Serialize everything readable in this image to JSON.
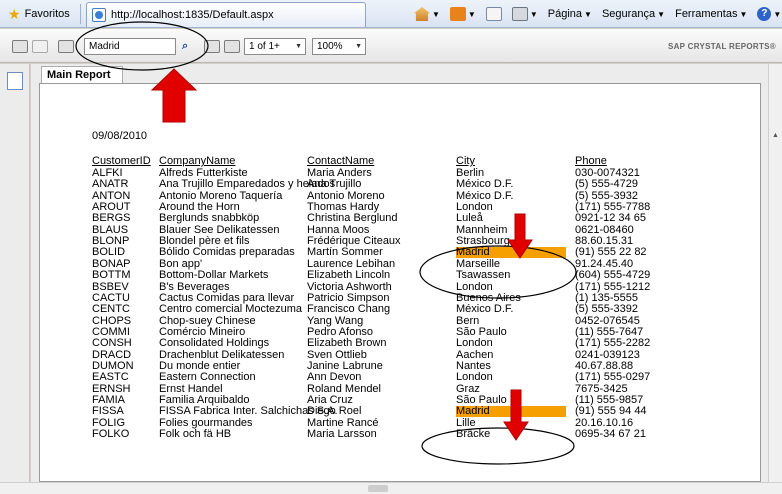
{
  "browser": {
    "favorites_label": "Favoritos",
    "tab_title": "http://localhost:1835/Default.aspx",
    "menu_page": "Página",
    "menu_security": "Segurança",
    "menu_tools": "Ferramentas"
  },
  "crystal": {
    "search_value": "Madrid",
    "page_value": "1 of 1+",
    "zoom_value": "100%",
    "brand": "SAP CRYSTAL REPORTS®",
    "main_tab": "Main Report"
  },
  "report": {
    "date": "09/08/2010",
    "columns": [
      "CustomerID",
      "CompanyName",
      "ContactName",
      "City",
      "Phone"
    ],
    "highlight_color": "#f5a000",
    "rows": [
      [
        "ALFKI",
        "Alfreds Futterkiste",
        "Maria Anders",
        "Berlin",
        "030-0074321"
      ],
      [
        "ANATR",
        "Ana Trujillo Emparedados y helados",
        "Ana Trujillo",
        "México D.F.",
        "(5) 555-4729"
      ],
      [
        "ANTON",
        "Antonio Moreno Taquería",
        "Antonio Moreno",
        "México D.F.",
        "(5) 555-3932"
      ],
      [
        "AROUT",
        "Around the Horn",
        "Thomas Hardy",
        "London",
        "(171) 555-7788"
      ],
      [
        "BERGS",
        "Berglunds snabbköp",
        "Christina Berglund",
        "Luleå",
        "0921-12 34 65"
      ],
      [
        "BLAUS",
        "Blauer See Delikatessen",
        "Hanna Moos",
        "Mannheim",
        "0621-08460"
      ],
      [
        "BLONP",
        "Blondel père et fils",
        "Frédérique Citeaux",
        "Strasbourg",
        "88.60.15.31"
      ],
      [
        "BOLID",
        "Bólido Comidas preparadas",
        "Martín Sommer",
        "Madrid",
        "(91) 555 22 82"
      ],
      [
        "BONAP",
        "Bon app'",
        "Laurence Lebihan",
        "Marseille",
        "91.24.45.40"
      ],
      [
        "BOTTM",
        "Bottom-Dollar Markets",
        "Elizabeth Lincoln",
        "Tsawassen",
        "(604) 555-4729"
      ],
      [
        "BSBEV",
        "B's Beverages",
        "Victoria Ashworth",
        "London",
        "(171) 555-1212"
      ],
      [
        "CACTU",
        "Cactus Comidas para llevar",
        "Patricio Simpson",
        "Buenos Aires",
        "(1) 135-5555"
      ],
      [
        "CENTC",
        "Centro comercial Moctezuma",
        "Francisco Chang",
        "México D.F.",
        "(5) 555-3392"
      ],
      [
        "CHOPS",
        "Chop-suey Chinese",
        "Yang Wang",
        "Bern",
        "0452-076545"
      ],
      [
        "COMMI",
        "Comércio Mineiro",
        "Pedro Afonso",
        "São Paulo",
        "(11) 555-7647"
      ],
      [
        "CONSH",
        "Consolidated Holdings",
        "Elizabeth Brown",
        "London",
        "(171) 555-2282"
      ],
      [
        "DRACD",
        "Drachenblut Delikatessen",
        "Sven Ottlieb",
        "Aachen",
        "0241-039123"
      ],
      [
        "DUMON",
        "Du monde entier",
        "Janine Labrune",
        "Nantes",
        "40.67.88.88"
      ],
      [
        "EASTC",
        "Eastern Connection",
        "Ann Devon",
        "London",
        "(171) 555-0297"
      ],
      [
        "ERNSH",
        "Ernst Handel",
        "Roland Mendel",
        "Graz",
        "7675-3425"
      ],
      [
        "FAMIA",
        "Familia Arquibaldo",
        "Aria Cruz",
        "São Paulo",
        "(11) 555-9857"
      ],
      [
        "FISSA",
        "FISSA Fabrica Inter. Salchichas S.A.",
        "Diego Roel",
        "Madrid",
        "(91) 555 94 44"
      ],
      [
        "FOLIG",
        "Folies gourmandes",
        "Martine Rancé",
        "Lille",
        "20.16.10.16"
      ],
      [
        "FOLKO",
        "Folk och fä HB",
        "Maria Larsson",
        "Bräcke",
        "0695-34 67 21"
      ]
    ]
  }
}
